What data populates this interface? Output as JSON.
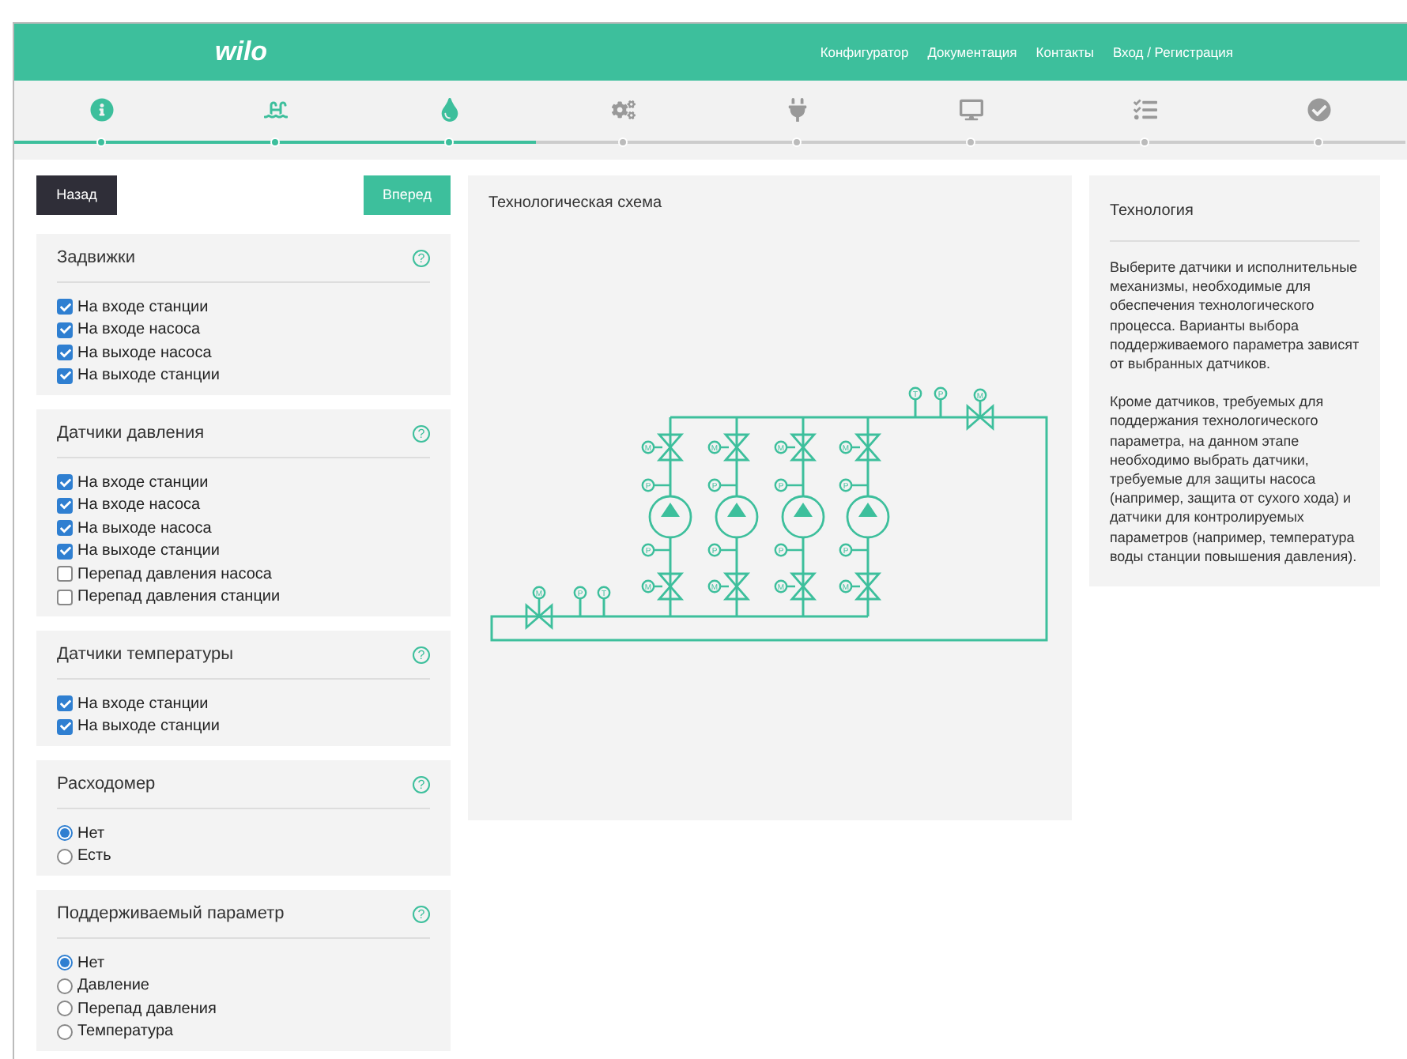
{
  "header": {
    "logo": "wilo",
    "nav": [
      "Конфигуратор",
      "Документация",
      "Контакты",
      "Вход / Регистрация"
    ]
  },
  "steps": [
    {
      "done": true
    },
    {
      "done": true
    },
    {
      "done": true
    },
    {
      "done": false
    },
    {
      "done": false
    },
    {
      "done": false
    },
    {
      "done": false
    },
    {
      "done": false
    }
  ],
  "buttons": {
    "back": "Назад",
    "next": "Вперед"
  },
  "sections": [
    {
      "title": "Задвижки",
      "help": "?",
      "kind": "checkbox",
      "options": [
        {
          "label": "На входе станции",
          "checked": true
        },
        {
          "label": "На входе насоса",
          "checked": true
        },
        {
          "label": "На выходе насоса",
          "checked": true
        },
        {
          "label": "На выходе станции",
          "checked": true
        }
      ]
    },
    {
      "title": "Датчики давления",
      "help": "?",
      "kind": "checkbox",
      "options": [
        {
          "label": "На входе станции",
          "checked": true
        },
        {
          "label": "На входе насоса",
          "checked": true
        },
        {
          "label": "На выходе насоса",
          "checked": true
        },
        {
          "label": "На выходе станции",
          "checked": true
        },
        {
          "label": "Перепад давления насоса",
          "checked": false
        },
        {
          "label": "Перепад давления станции",
          "checked": false
        }
      ]
    },
    {
      "title": "Датчики температуры",
      "help": "?",
      "kind": "checkbox",
      "options": [
        {
          "label": "На входе станции",
          "checked": true
        },
        {
          "label": "На выходе станции",
          "checked": true
        }
      ]
    },
    {
      "title": "Расходомер",
      "help": "?",
      "kind": "radio",
      "options": [
        {
          "label": "Нет",
          "selected": true
        },
        {
          "label": "Есть",
          "selected": false
        }
      ]
    },
    {
      "title": "Поддерживаемый параметр",
      "help": "?",
      "kind": "radio",
      "options": [
        {
          "label": "Нет",
          "selected": true
        },
        {
          "label": "Давление",
          "selected": false
        },
        {
          "label": "Перепад давления",
          "selected": false
        },
        {
          "label": "Температура",
          "selected": false
        }
      ]
    }
  ],
  "schematic": {
    "title": "Технологическая схема",
    "inlet": {
      "valve": "M",
      "gauges": [
        "P",
        "T"
      ]
    },
    "outlet": {
      "gauges": [
        "T",
        "P"
      ],
      "valve": "M"
    },
    "pumps": [
      {
        "top_valve": "M",
        "top_gauge": "P",
        "bottom_gauge": "P",
        "bottom_valve": "M"
      },
      {
        "top_valve": "M",
        "top_gauge": "P",
        "bottom_gauge": "P",
        "bottom_valve": "M"
      },
      {
        "top_valve": "M",
        "top_gauge": "P",
        "bottom_gauge": "P",
        "bottom_valve": "M"
      },
      {
        "top_valve": "M",
        "top_gauge": "P",
        "bottom_gauge": "P",
        "bottom_valve": "M"
      }
    ]
  },
  "info": {
    "title": "Технология",
    "paragraphs": [
      "Выберите датчики и исполнительные механизмы, необходимые для обеспечения технологического процесса. Варианты выбора поддерживаемого параметра зависят от выбранных датчиков.",
      "Кроме датчиков, требуемых для поддержания технологического параметра, на данном этапе необходимо выбрать датчики, требуемые для защиты насоса (например, защита от сухого хода) и датчики для контролируемых параметров (например, температура воды станции повышения давления)."
    ]
  }
}
